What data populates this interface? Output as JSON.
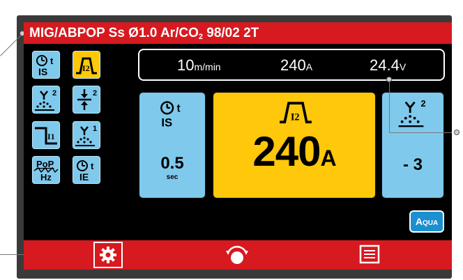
{
  "title": {
    "text_main": "MIG/ABPOP  Ss Ø1.0 Ar/CO",
    "text_sub": "2",
    "text_tail": "  98/02 2T"
  },
  "readout": {
    "wire_speed": "10",
    "wire_speed_unit": "m/min",
    "current": "240",
    "current_unit": "A",
    "voltage": "24.4",
    "voltage_unit": "V"
  },
  "icon_buttons": [
    {
      "name": "start-time-is-icon",
      "label": "IS",
      "selected": false
    },
    {
      "name": "current-i2-icon",
      "label": "I2",
      "selected": true
    },
    {
      "name": "arc-dynamics-2-icon",
      "label": "2",
      "selected": false
    },
    {
      "name": "wire-pinch-2-icon",
      "label": "2",
      "selected": false
    },
    {
      "name": "current-i1-icon",
      "label": "I1",
      "selected": false
    },
    {
      "name": "arc-dynamics-1-icon",
      "label": "1",
      "selected": false
    },
    {
      "name": "pop-frequency-icon",
      "label": "PoP Hz",
      "selected": false
    },
    {
      "name": "end-time-ie-icon",
      "label": "IE",
      "selected": false
    }
  ],
  "panel_left": {
    "param": "IS",
    "value": "0.5",
    "unit": "sec"
  },
  "panel_mid": {
    "param": "I2",
    "value": "240",
    "unit": "A"
  },
  "panel_right": {
    "param": "2",
    "value": "- 3"
  },
  "aqua": {
    "big": "A",
    "small": "QUA"
  },
  "colors": {
    "title_bar": "#d71920",
    "button_blue": "#7fc9ec",
    "selected_yellow": "#ffc80a",
    "screen_bg": "#000000"
  }
}
